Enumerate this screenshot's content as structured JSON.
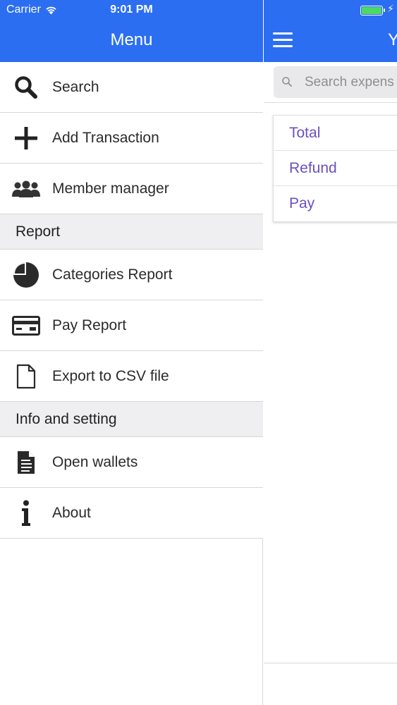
{
  "status_bar": {
    "carrier": "Carrier",
    "time": "9:01 PM",
    "battery_color": "#4cd964"
  },
  "drawer": {
    "title": "Menu",
    "items": [
      {
        "label": "Search",
        "icon": "search-icon"
      },
      {
        "label": "Add Transaction",
        "icon": "plus-icon"
      },
      {
        "label": "Member manager",
        "icon": "users-icon"
      }
    ],
    "sections": [
      {
        "header": "Report",
        "items": [
          {
            "label": "Categories Report",
            "icon": "pie-chart-icon"
          },
          {
            "label": "Pay Report",
            "icon": "credit-card-icon"
          },
          {
            "label": "Export to CSV file",
            "icon": "file-icon"
          }
        ]
      },
      {
        "header": "Info and setting",
        "items": [
          {
            "label": "Open wallets",
            "icon": "document-icon"
          },
          {
            "label": "About",
            "icon": "info-icon"
          }
        ]
      }
    ]
  },
  "content": {
    "title_partial": "Y",
    "search": {
      "placeholder": "Search expens"
    },
    "summary": [
      "Total",
      "Refund",
      "Pay"
    ]
  },
  "colors": {
    "header_bg": "#2b6ef2",
    "summary_text": "#6a4fc2",
    "section_bg": "#efeff1"
  }
}
